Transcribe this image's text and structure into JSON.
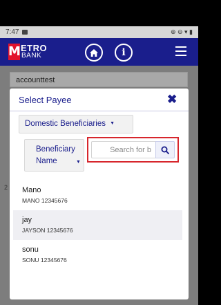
{
  "status_bar": {
    "time": "7:47",
    "right_icons": "⊕ ⊖ ▾ ▮"
  },
  "app_bar": {
    "logo_letter": "M",
    "logo_top": "ETRO",
    "logo_bottom": "BANK",
    "home_icon": "home-icon",
    "info_label": "i",
    "menu_icon": "hamburger-menu-icon",
    "brand_color": "#1a1e8c",
    "logo_red": "#e3132d"
  },
  "background": {
    "account_field_text": "accounttest",
    "partial_marker": "2"
  },
  "modal": {
    "title": "Select Payee",
    "close_icon": "close-icon",
    "beneficiary_category": "Domestic Beneficiaries",
    "search_type": "Beneficiary Name",
    "search": {
      "value": "",
      "placeholder": "Search for b",
      "highlight_color": "#d7262c"
    },
    "payees": [
      {
        "name": "Mano",
        "detail": "MANO 12345676"
      },
      {
        "name": "jay",
        "detail": "JAYSON 12345676"
      },
      {
        "name": "sonu",
        "detail": "SONU 12345676"
      }
    ]
  }
}
